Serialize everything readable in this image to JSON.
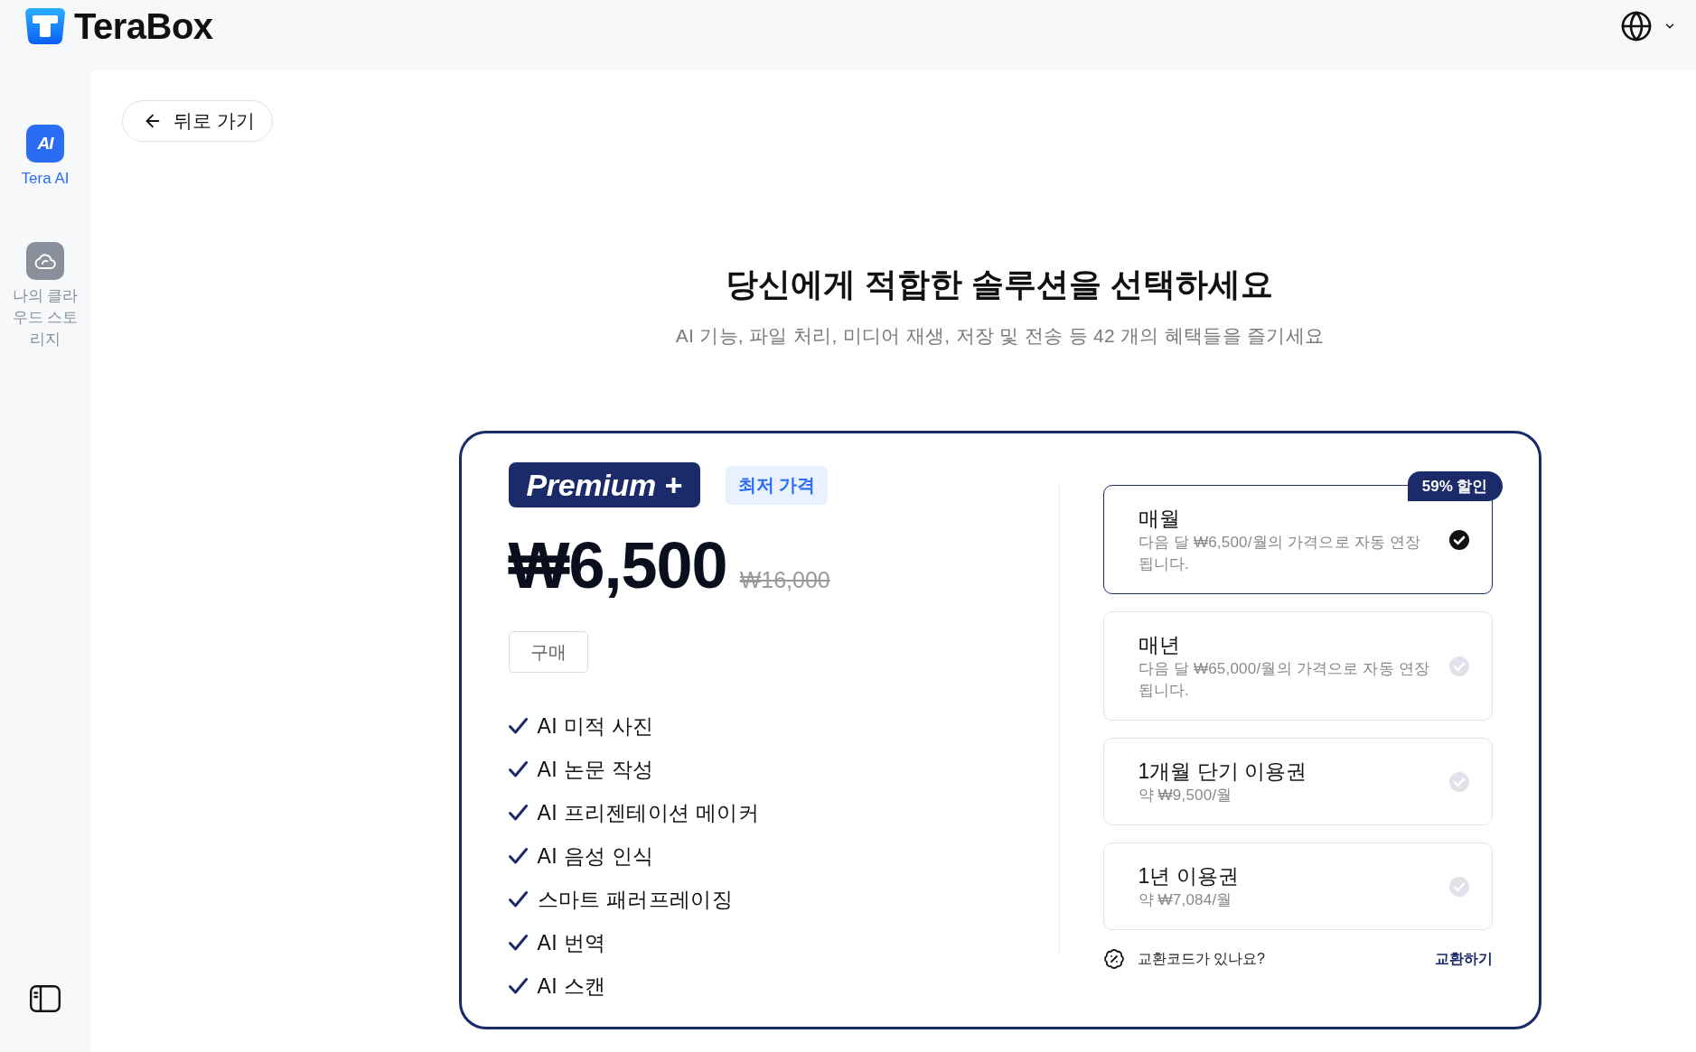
{
  "header": {
    "brand": "TeraBox"
  },
  "sidebar": {
    "items": [
      {
        "kind": "ai",
        "icon_text": "AI",
        "label": "Tera AI",
        "selected": true
      },
      {
        "kind": "cloud",
        "label": "나의 클라우드 스토리지",
        "selected": false
      }
    ]
  },
  "back_button": {
    "label": "뒤로 가기"
  },
  "heading": {
    "title": "당신에게 적합한 솔루션을 선택하세요",
    "subtitle": "AI 기능, 파일 처리, 미디어 재생, 저장 및 전송 등 42 개의 혜택들을 즐기세요"
  },
  "plan": {
    "name": "Premium +",
    "tag": "최저 가격",
    "price": "₩6,500",
    "original_price": "₩16,000",
    "buy_button": "구매",
    "features": [
      "AI 미적 사진",
      "AI 논문 작성",
      "AI 프리젠테이션 메이커",
      "AI 음성 인식",
      "스마트 패러프레이징",
      "AI 번역",
      "AI 스캔"
    ]
  },
  "options": [
    {
      "title": "매월",
      "description": "다음 달 ₩6,500/월의 가격으로 자동 연장 됩니다.",
      "badge": "59% 할인",
      "selected": true
    },
    {
      "title": "매년",
      "description": "다음 달 ₩65,000/월의 가격으로 자동 연장 됩니다.",
      "selected": false
    },
    {
      "title": "1개월 단기 이용권",
      "description": "약 ₩9,500/월",
      "selected": false
    },
    {
      "title": "1년 이용권",
      "description": "약 ₩7,084/월",
      "selected": false
    }
  ],
  "redeem": {
    "prompt": "교환코드가 있나요?",
    "link": "교환하기"
  }
}
